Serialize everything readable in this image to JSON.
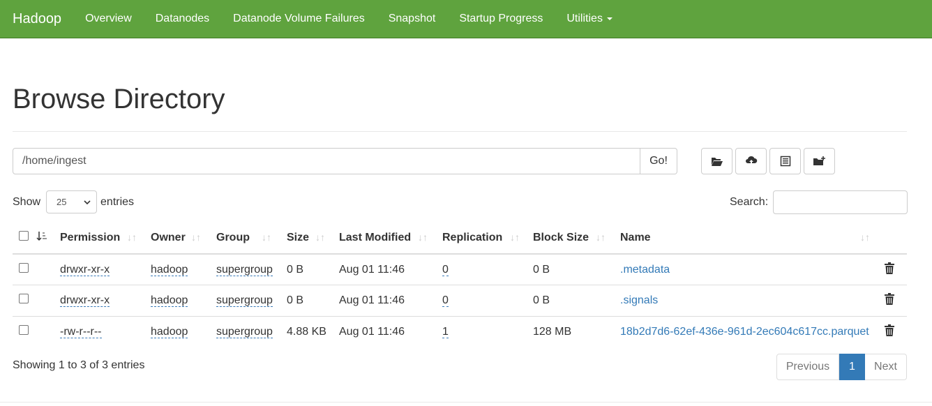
{
  "nav": {
    "brand": "Hadoop",
    "items": [
      "Overview",
      "Datanodes",
      "Datanode Volume Failures",
      "Snapshot",
      "Startup Progress",
      "Utilities"
    ]
  },
  "page_title": "Browse Directory",
  "path": {
    "value": "/home/ingest",
    "go_label": "Go!"
  },
  "tools": [
    "folder-open-icon",
    "upload-cloud-icon",
    "list-icon",
    "new-folder-icon"
  ],
  "length": {
    "show": "Show",
    "value": "25",
    "entries": "entries"
  },
  "search": {
    "label": "Search:"
  },
  "table": {
    "headers": [
      "Permission",
      "Owner",
      "Group",
      "Size",
      "Last Modified",
      "Replication",
      "Block Size",
      "Name"
    ],
    "rows": [
      {
        "permission": "drwxr-xr-x",
        "owner": "hadoop",
        "group": "supergroup",
        "size": "0 B",
        "modified": "Aug 01 11:46",
        "replication": "0",
        "block_size": "0 B",
        "name": ".metadata"
      },
      {
        "permission": "drwxr-xr-x",
        "owner": "hadoop",
        "group": "supergroup",
        "size": "0 B",
        "modified": "Aug 01 11:46",
        "replication": "0",
        "block_size": "0 B",
        "name": ".signals"
      },
      {
        "permission": "-rw-r--r--",
        "owner": "hadoop",
        "group": "supergroup",
        "size": "4.88 KB",
        "modified": "Aug 01 11:46",
        "replication": "1",
        "block_size": "128 MB",
        "name": "18b2d7d6-62ef-436e-961d-2ec604c617cc.parquet"
      }
    ]
  },
  "info": "Showing 1 to 3 of 3 entries",
  "pager": {
    "previous": "Previous",
    "current": "1",
    "next": "Next"
  },
  "colors": {
    "navbar": "#5fa33e",
    "link": "#337ab7"
  }
}
